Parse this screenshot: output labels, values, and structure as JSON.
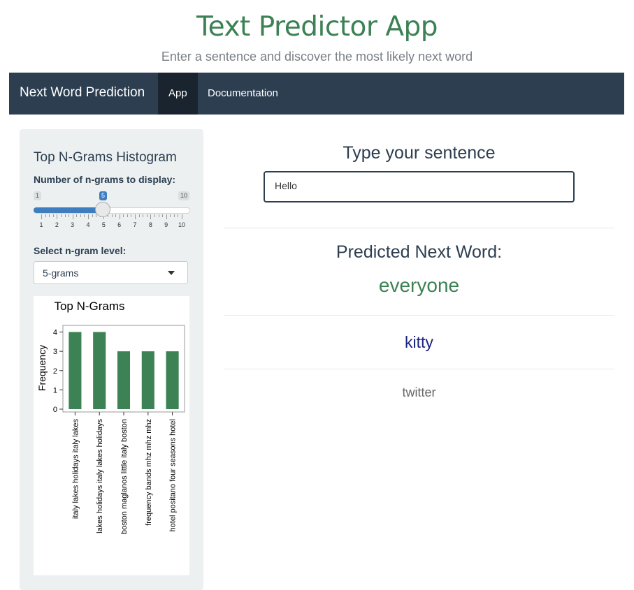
{
  "header": {
    "title": "Text Predictor App",
    "subtitle": "Enter a sentence and discover the most likely next word"
  },
  "navbar": {
    "brand": "Next Word Prediction",
    "tabs": [
      {
        "label": "App",
        "active": true
      },
      {
        "label": "Documentation",
        "active": false
      }
    ],
    "color": "#2c3e50"
  },
  "sidebar": {
    "title": "Top N-Grams Histogram",
    "slider": {
      "label": "Number of n-grams to display:",
      "min": 1,
      "max": 10,
      "value": 5,
      "tick_labels": [
        "1",
        "2",
        "3",
        "4",
        "5",
        "6",
        "7",
        "8",
        "9",
        "10"
      ]
    },
    "select": {
      "label": "Select n-gram level:",
      "value": "5-grams"
    }
  },
  "main": {
    "input_heading": "Type your sentence",
    "input_value": "Hello",
    "prediction_heading": "Predicted Next Word:",
    "predictions": [
      "everyone",
      "kitty",
      "twitter"
    ]
  },
  "chart_data": {
    "type": "bar",
    "title": "Top N-Grams",
    "xlabel": "",
    "ylabel": "Frequency",
    "categories": [
      "italy lakes holidays italy lakes",
      "lakes holidays italy lakes holidays",
      "boston maglanos little italy boston",
      "frequency bands mhz mhz mhz",
      "hotel positano four seasons hotel"
    ],
    "values": [
      4,
      4,
      3,
      3,
      3
    ],
    "ylim": [
      0,
      4.2
    ],
    "yticks": [
      0,
      1,
      2,
      3,
      4
    ],
    "bar_color": "#3c8254",
    "grid": false
  },
  "colors": {
    "accent_green": "#3c8254",
    "slider_blue": "#3e7dc0",
    "second_prediction": "#1a237e",
    "third_prediction": "#666666"
  }
}
